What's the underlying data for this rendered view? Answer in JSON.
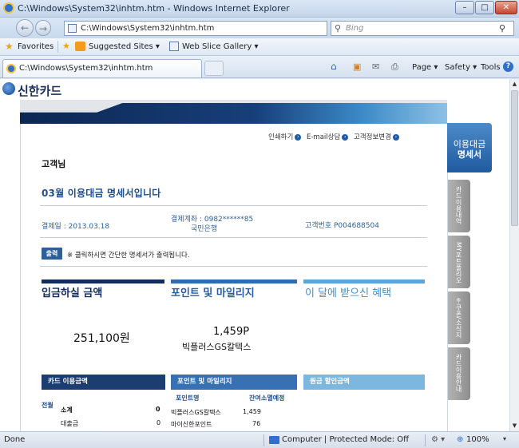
{
  "window": {
    "title": "C:\\Windows\\System32\\inhtm.htm - Windows Internet Explorer",
    "min_glyph": "–",
    "max_glyph": "□",
    "close_glyph": "✕"
  },
  "nav": {
    "back_glyph": "←",
    "forward_glyph": "→",
    "address": "C:\\Windows\\System32\\inhtm.htm",
    "search_placeholder": "Bing",
    "dropdown_glyph": "▾",
    "refresh_glyph": "↻",
    "stop_glyph": "✕",
    "search_glyph": "⚲"
  },
  "favorites": {
    "label": "Favorites",
    "items": [
      "Suggested Sites ▾",
      "Web Slice Gallery ▾"
    ]
  },
  "tab": {
    "label": "C:\\Windows\\System32\\inhtm.htm"
  },
  "commands": {
    "home_glyph": "⌂",
    "feeds_glyph": "▣",
    "mail_glyph": "✉",
    "print_glyph": "⎙",
    "page": "Page ▾",
    "safety": "Safety ▾",
    "tools": "Tools ▾",
    "help_glyph": "?"
  },
  "page": {
    "logo": "신한카드",
    "links": [
      "인쇄하기",
      "E-mail상담",
      "고객정보변경"
    ],
    "link_dot_glyph": "›",
    "customer": "고객님",
    "statement_title": "03월 이용대금 명세서입니다",
    "payday": "결제일 : 2013.03.18",
    "account_line1": "결제계좌 : 0982******85",
    "account_line2": "국민은행",
    "customer_no": "고객번호 P004688504",
    "print_button": "출력",
    "print_note": "※ 클릭하시면 간단한 명세서가 출력됩니다.",
    "col_headers": [
      "입금하실 금액",
      "포인트 및 마일리지",
      "이 달에 받으신 혜택"
    ],
    "amount": "251,100원",
    "points": "1,459P",
    "points_brand": "빅플러스GS칼텍스",
    "sub_headers": [
      "카드 이용금액",
      "포인트 및 마일리지",
      "원금 할인금액"
    ],
    "card_table": {
      "group_label": "전월",
      "rows": [
        {
          "label": "소계",
          "value": "0"
        },
        {
          "label": "대출금",
          "value": "0"
        }
      ]
    },
    "point_table": {
      "headers": [
        "포인트명",
        "잔여",
        "소멸예정"
      ],
      "rows": [
        {
          "name": "빅플러스GS칼텍스",
          "balance": "1,459"
        },
        {
          "name": "마이신한포인트",
          "balance": "76"
        }
      ]
    },
    "side_active": [
      "이용대금",
      "명세서"
    ],
    "side_tabs": [
      "카드이용내역",
      "MY포트폴리오",
      "e-쿠폰/소식지",
      "카드이용안내"
    ]
  },
  "scroll": {
    "up_glyph": "▲",
    "down_glyph": "▼"
  },
  "status": {
    "left": "Done",
    "zone": "Computer | Protected Mode: Off",
    "gear_glyph": "⚙ ▾",
    "zoom_glyph": "⊕",
    "zoom": "100%",
    "zoom_drop_glyph": "▾"
  }
}
